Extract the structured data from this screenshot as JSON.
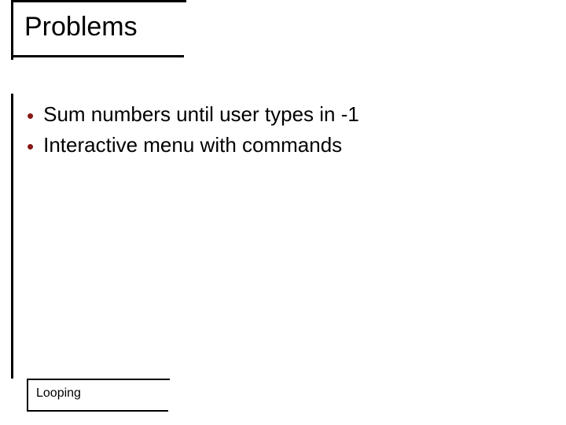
{
  "title": "Problems",
  "bullets": [
    "Sum numbers until user types in -1",
    "Interactive menu with commands"
  ],
  "footer": "Looping"
}
